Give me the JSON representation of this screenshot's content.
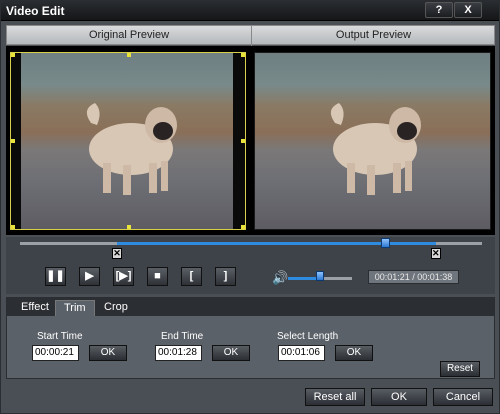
{
  "window": {
    "title": "Video Edit"
  },
  "titlebar": {
    "help_label": "?",
    "close_label": "X"
  },
  "preview": {
    "original_label": "Original Preview",
    "output_label": "Output Preview"
  },
  "player": {
    "time_display": "00:01:21 / 00:01:38",
    "progress_fraction": 0.79,
    "trim_start_fraction": 0.21,
    "trim_end_fraction": 0.9,
    "volume_fraction": 0.5,
    "buttons": [
      "pause",
      "play",
      "play-selection",
      "stop",
      "set-start",
      "set-end"
    ]
  },
  "tabs": [
    {
      "label": "Effect",
      "active": false
    },
    {
      "label": "Trim",
      "active": true
    },
    {
      "label": "Crop",
      "active": false
    }
  ],
  "trim": {
    "start_label": "Start Time",
    "start_value": "00:00:21",
    "end_label": "End Time",
    "end_value": "00:01:28",
    "length_label": "Select Length",
    "length_value": "00:01:06",
    "ok_label": "OK",
    "reset_label": "Reset"
  },
  "footer": {
    "reset_all_label": "Reset all",
    "ok_label": "OK",
    "cancel_label": "Cancel"
  },
  "colors": {
    "accent": "#2f8be0",
    "crop_frame": "#d6d04a"
  }
}
